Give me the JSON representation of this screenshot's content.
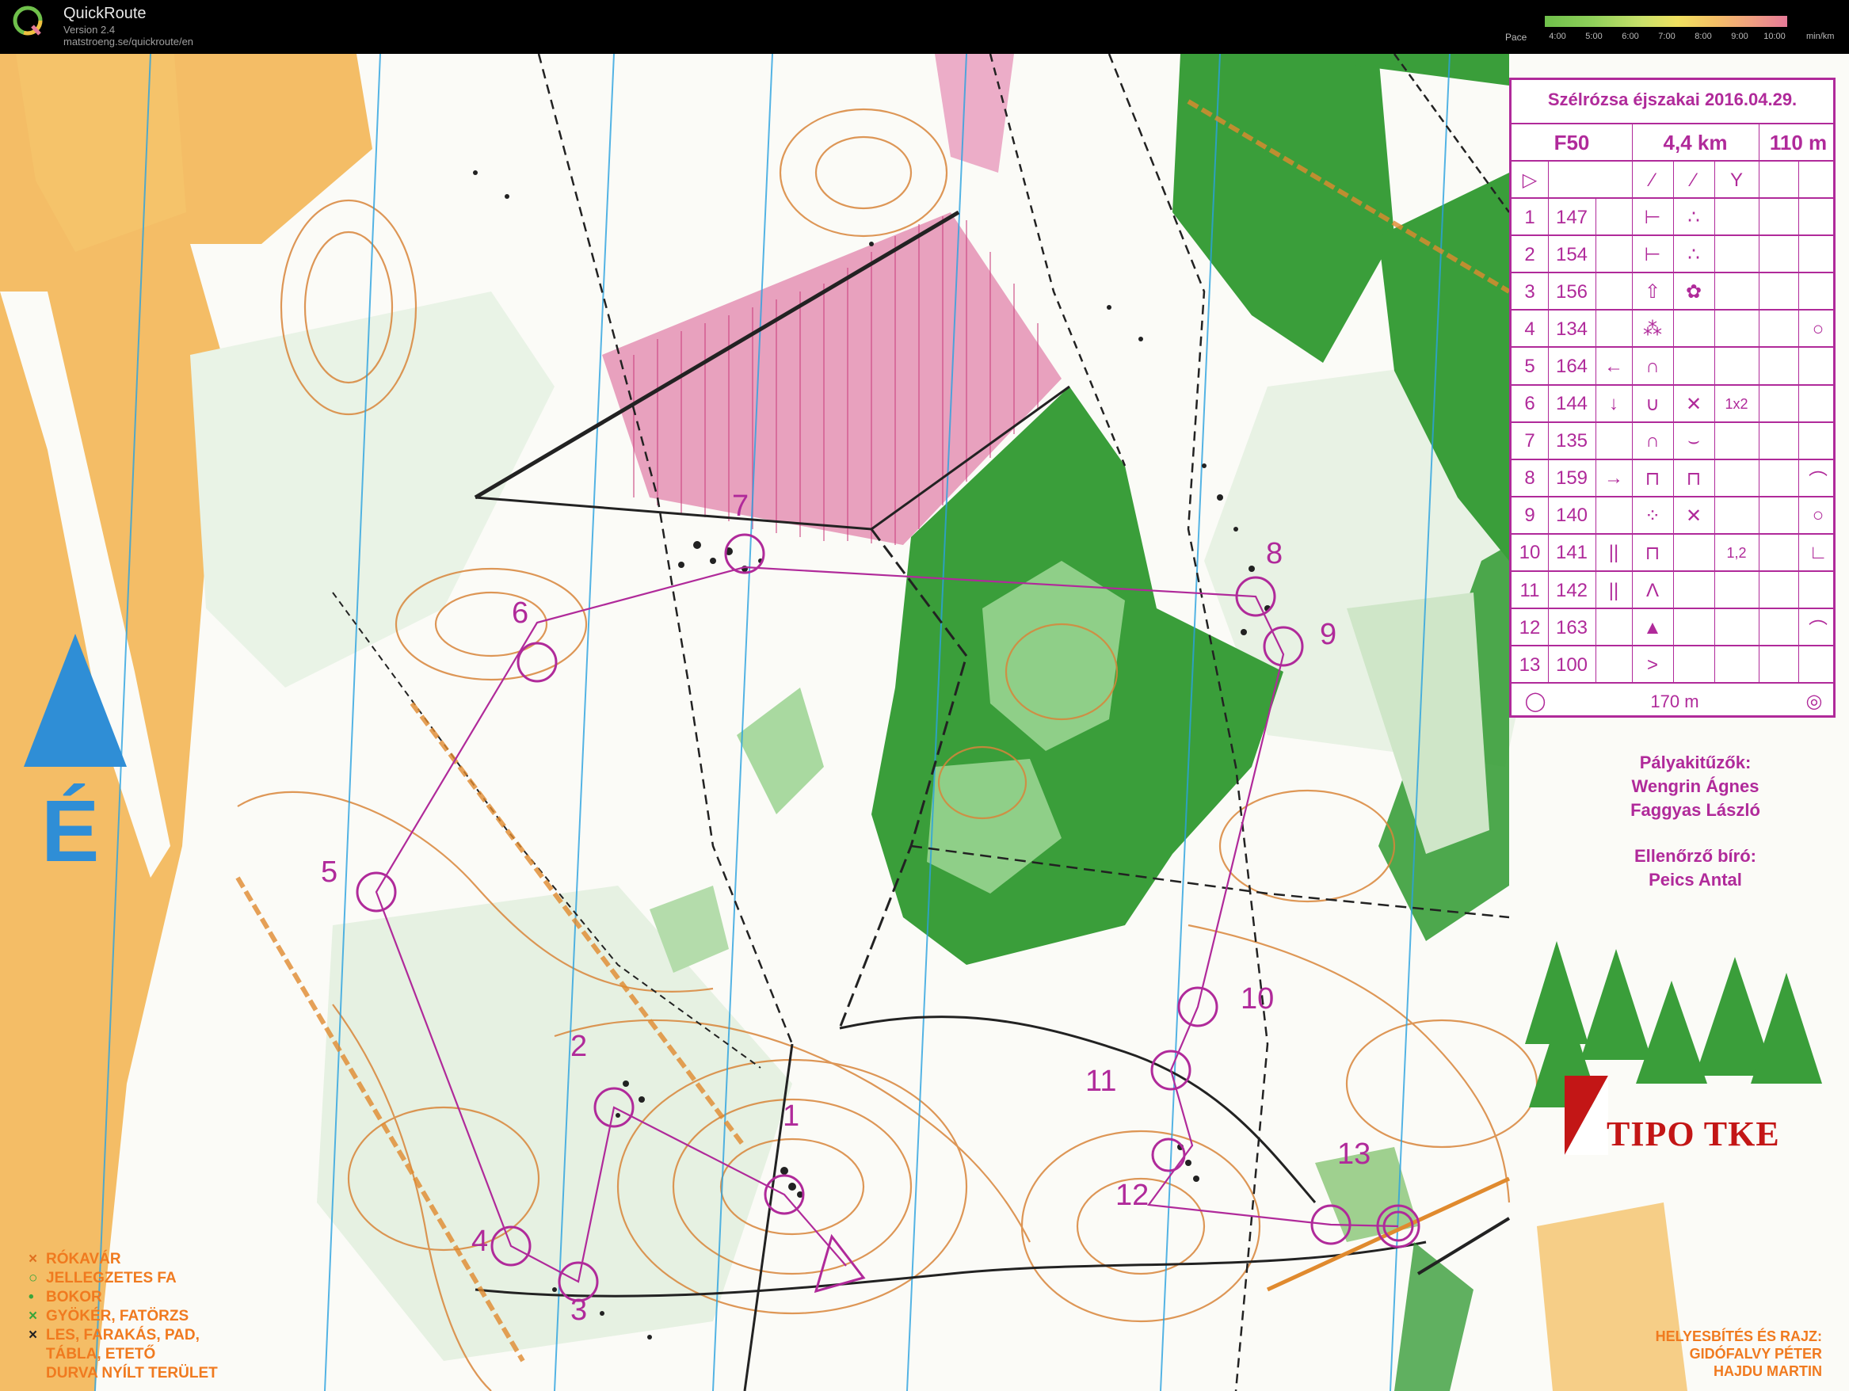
{
  "app": {
    "name": "QuickRoute",
    "version": "Version 2.4",
    "url": "matstroeng.se/quickroute/en"
  },
  "pace_legend": {
    "label": "Pace",
    "ticks": [
      "4:00",
      "5:00",
      "6:00",
      "7:00",
      "8:00",
      "9:00",
      "10:00"
    ],
    "unit": "min/km"
  },
  "description_sheet": {
    "event": "Szélrózsa éjszakai 2016.04.29.",
    "category": "F50",
    "length": "4,4 km",
    "climb": "110 m",
    "controls": [
      {
        "num": "1",
        "code": "147",
        "feature": "Y-shape",
        "detail": "rocky"
      },
      {
        "num": "2",
        "code": "154",
        "feature": "Y-shape",
        "detail": "rocky"
      },
      {
        "num": "3",
        "code": "156",
        "feature": "tree",
        "detail": "bush"
      },
      {
        "num": "4",
        "code": "134",
        "feature": "stony",
        "detail": "",
        "extra": "",
        "location": "O"
      },
      {
        "num": "5",
        "code": "164",
        "direction": "←",
        "feature": "hill"
      },
      {
        "num": "6",
        "code": "144",
        "direction": "↓",
        "feature": "U",
        "detail": "X",
        "extra": "1x2"
      },
      {
        "num": "7",
        "code": "135",
        "feature": "hill",
        "detail": "ditch"
      },
      {
        "num": "8",
        "code": "159",
        "direction": "→",
        "feature": "wall",
        "detail": "wall",
        "location": "top"
      },
      {
        "num": "9",
        "code": "140",
        "feature": "dots",
        "detail": "X",
        "location": "O"
      },
      {
        "num": "10",
        "code": "141",
        "direction": "||",
        "feature": "wall",
        "extra": "1,2",
        "location": "L"
      },
      {
        "num": "11",
        "code": "142",
        "direction": "||",
        "feature": "peak"
      },
      {
        "num": "12",
        "code": "163",
        "feature": "mountain",
        "location": "top"
      },
      {
        "num": "13",
        "code": "100",
        "feature": ">"
      }
    ],
    "finish_distance": "170 m"
  },
  "credits": {
    "course_setters_title": "Pályakitűzők:",
    "setter1": "Wengrin Ágnes",
    "setter2": "Faggyas László",
    "controller_title": "Ellenőrző bíró:",
    "controller": "Peics Antal"
  },
  "club": {
    "name_pre": "TIP",
    "name_post": "O TKE"
  },
  "north_label": "É",
  "legend": [
    {
      "mark": "×",
      "text": "RÓKAVÁR",
      "color": "#e07020"
    },
    {
      "mark": "○",
      "text": "JELLEGZETES FA",
      "color": "#3aa53a"
    },
    {
      "mark": "•",
      "text": "BOKOR",
      "color": "#3aa53a"
    },
    {
      "mark": "×",
      "text": "GYÖKÉR, FATÖRZS",
      "color": "#3aa53a"
    },
    {
      "mark": "×",
      "text": "LES, FARAKÁS, PAD,",
      "color": "#222"
    },
    {
      "mark": "",
      "text": "TÁBLA, ETETŐ",
      "color": "#222"
    },
    {
      "mark": "",
      "text": "DURVA NYÍLT TERÜLET",
      "color": "#222"
    }
  ],
  "author": {
    "line1": "HELYESBÍTÉS ÉS RAJZ:",
    "line2": "GIDÓFALVY PÉTER",
    "line3": "HAJDU MARTIN"
  },
  "control_labels": [
    "1",
    "2",
    "3",
    "4",
    "5",
    "6",
    "7",
    "8",
    "9",
    "10",
    "11",
    "12",
    "13"
  ],
  "colors": {
    "course": "#b02a9a",
    "forest": "#3a9e3a",
    "open": "#f2b24c",
    "contour": "#d8853a",
    "magnetic": "#2aa2e0"
  }
}
